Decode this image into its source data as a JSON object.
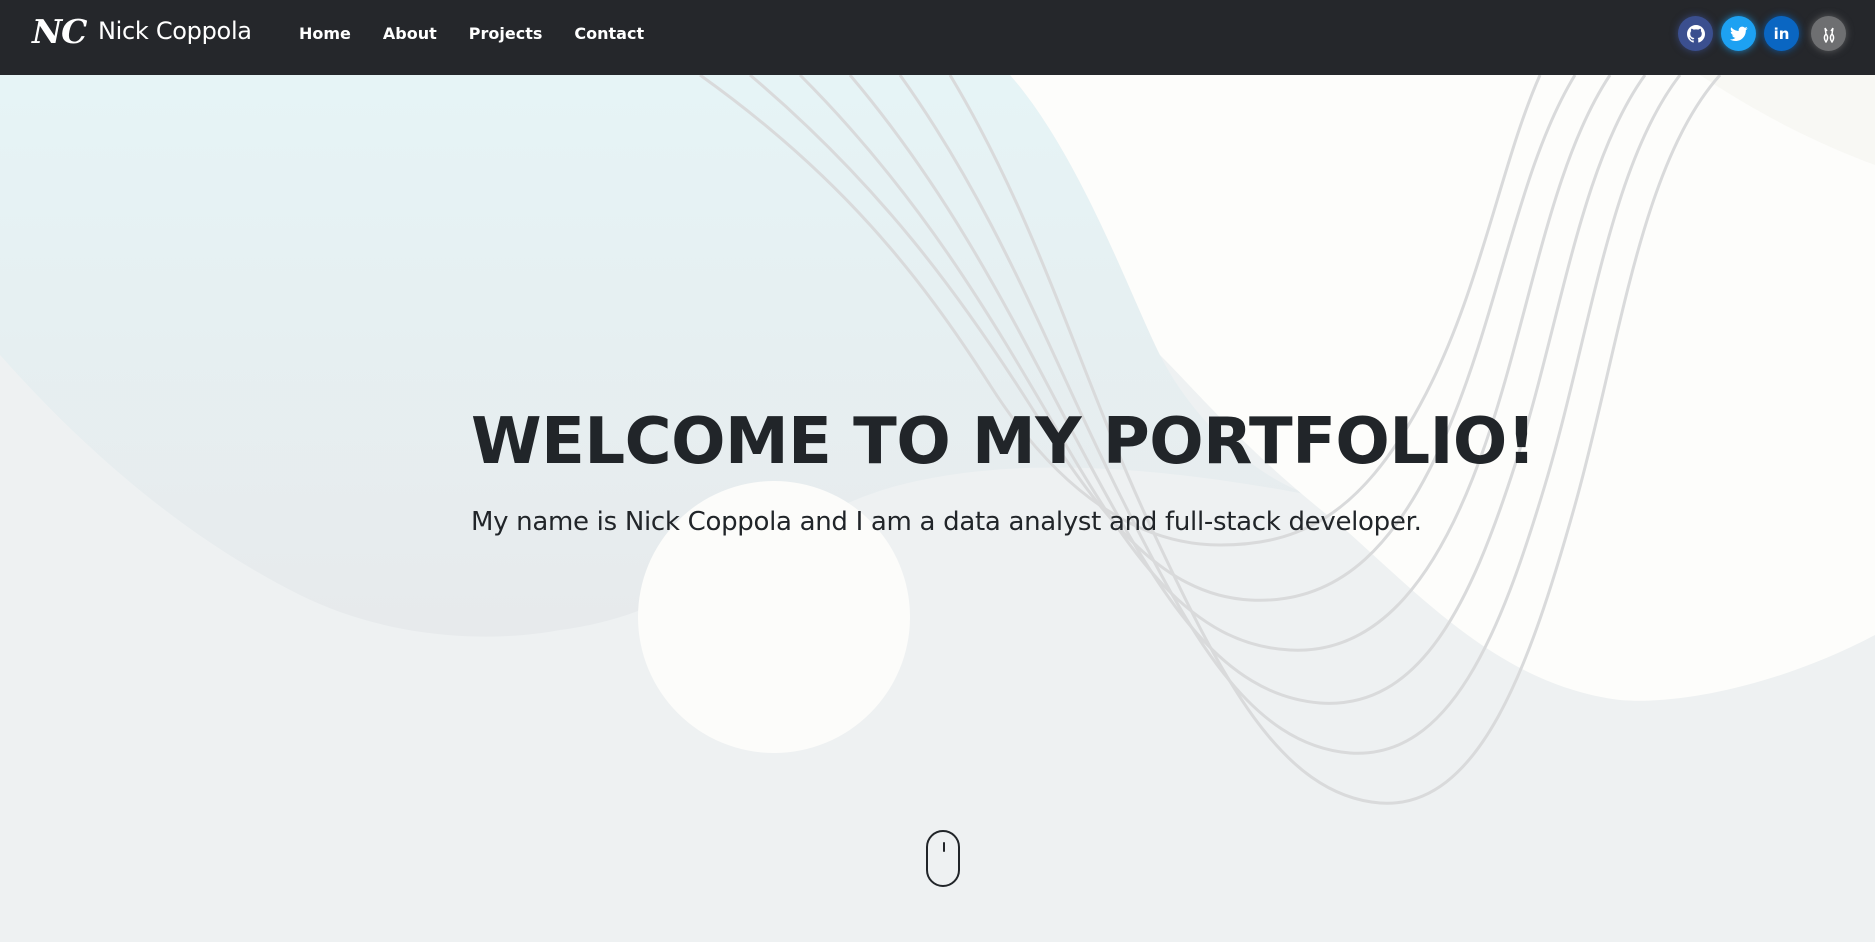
{
  "nav": {
    "logo": "NC",
    "brand": "Nick Coppola",
    "links": [
      "Home",
      "About",
      "Projects",
      "Contact"
    ],
    "social": [
      {
        "name": "github-icon",
        "color": "#3b4f8f"
      },
      {
        "name": "twitter-icon",
        "color": "#1da1f2"
      },
      {
        "name": "linkedin-icon",
        "color": "#0a66c2",
        "text": "in"
      },
      {
        "name": "kaggle-icon",
        "color": "#6e6f71"
      }
    ]
  },
  "hero": {
    "title": "WELCOME TO MY PORTFOLIO!",
    "subtitle": "My name is Nick Coppola and I am a data analyst and full-stack developer."
  },
  "colors": {
    "navbar": "#25272b",
    "text": "#212529",
    "background": "#eef0f1"
  }
}
